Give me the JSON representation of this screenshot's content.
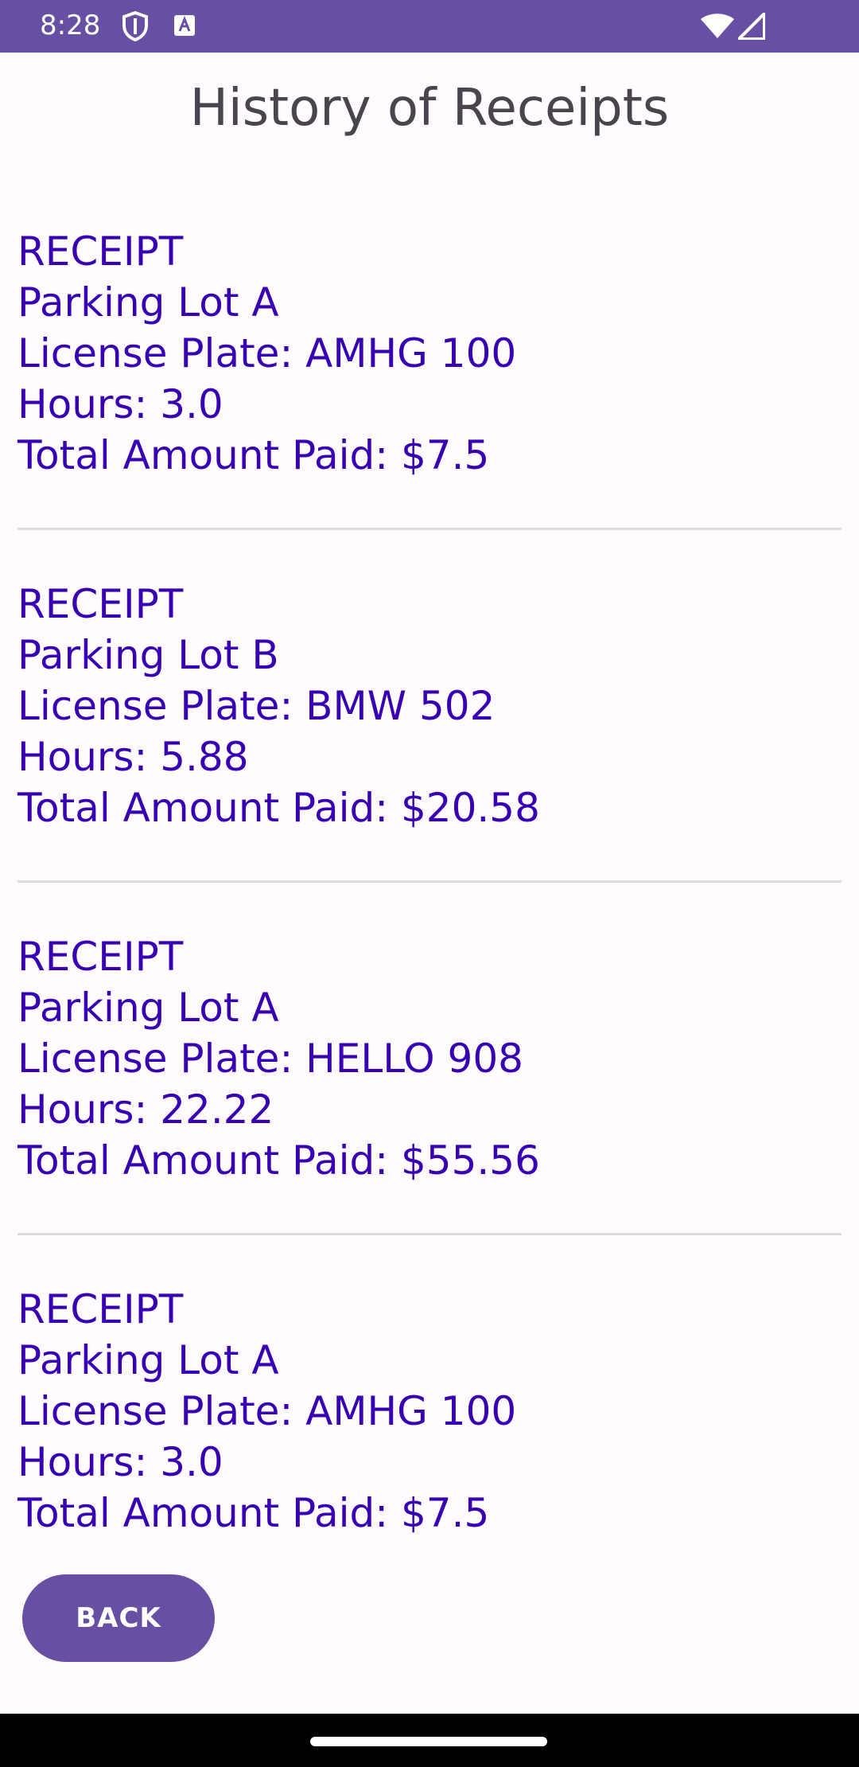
{
  "status_bar": {
    "time": "8:28",
    "icons": [
      "shield-icon",
      "keyboard-a-icon",
      "wifi-icon",
      "signal-icon"
    ],
    "color": "#6750a4"
  },
  "page": {
    "title": "History of Receipts"
  },
  "receipts": [
    {
      "heading": "RECEIPT",
      "lot": "Parking Lot A",
      "plate": "License Plate: AMHG 100",
      "hours": "Hours: 3.0",
      "total": "Total Amount Paid: $7.5"
    },
    {
      "heading": "RECEIPT",
      "lot": "Parking Lot B",
      "plate": "License Plate: BMW 502",
      "hours": "Hours: 5.88",
      "total": "Total Amount Paid: $20.58"
    },
    {
      "heading": "RECEIPT",
      "lot": "Parking Lot A",
      "plate": "License Plate: HELLO 908",
      "hours": "Hours: 22.22",
      "total": "Total Amount Paid: $55.56"
    },
    {
      "heading": "RECEIPT",
      "lot": "Parking Lot A",
      "plate": "License Plate: AMHG 100",
      "hours": "Hours: 3.0",
      "total": "Total Amount Paid: $7.5"
    }
  ],
  "actions": {
    "back_label": "BACK"
  },
  "colors": {
    "accent": "#6750a4",
    "receipt_text": "#3700b3",
    "title_text": "#49454f",
    "background": "#fffbfe"
  }
}
